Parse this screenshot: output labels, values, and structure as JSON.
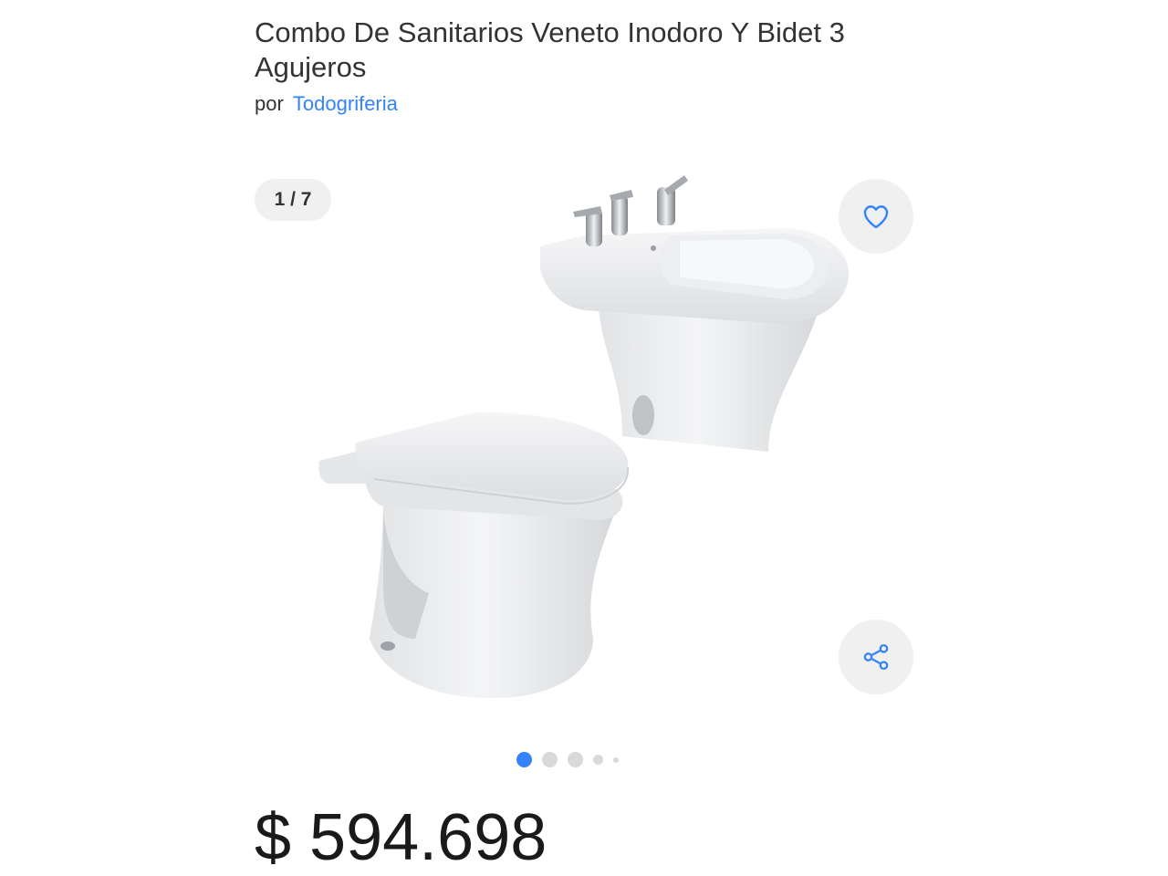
{
  "product": {
    "title": "Combo De Sanitarios Veneto Inodoro Y Bidet 3 Agujeros",
    "seller_prefix": "por",
    "seller_name": "Todogriferia"
  },
  "gallery": {
    "counter": "1 / 7",
    "current_index": 1,
    "total_images": 7,
    "pager_dots": 5,
    "active_dot": 0
  },
  "actions": {
    "favorite_icon": "heart-icon",
    "share_icon": "share-icon"
  },
  "price": {
    "display": "$ 594.698"
  },
  "colors": {
    "accent": "#3483fa",
    "text": "#333333",
    "button_bg": "#f0f0f0",
    "dot_inactive": "#d9d9d9"
  }
}
